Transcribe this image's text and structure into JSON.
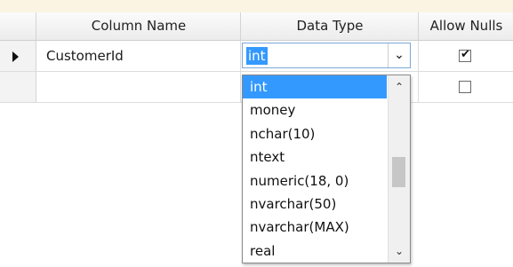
{
  "columns": [
    "Column Name",
    "Data Type",
    "Allow Nulls"
  ],
  "rows": [
    {
      "name": "CustomerId",
      "type": "int",
      "allow_nulls": true,
      "current": true
    },
    {
      "name": "",
      "type": "",
      "allow_nulls": false,
      "current": false
    }
  ],
  "combo": {
    "value": "int",
    "button_icon": "chevron-down-icon"
  },
  "dropdown": {
    "items": [
      "int",
      "money",
      "nchar(10)",
      "ntext",
      "numeric(18, 0)",
      "nvarchar(50)",
      "nvarchar(MAX)",
      "real"
    ],
    "selected_index": 0
  },
  "colors": {
    "selection": "#3399ff",
    "header_bg": "#ececec",
    "top_strip": "#fbf4e3"
  }
}
